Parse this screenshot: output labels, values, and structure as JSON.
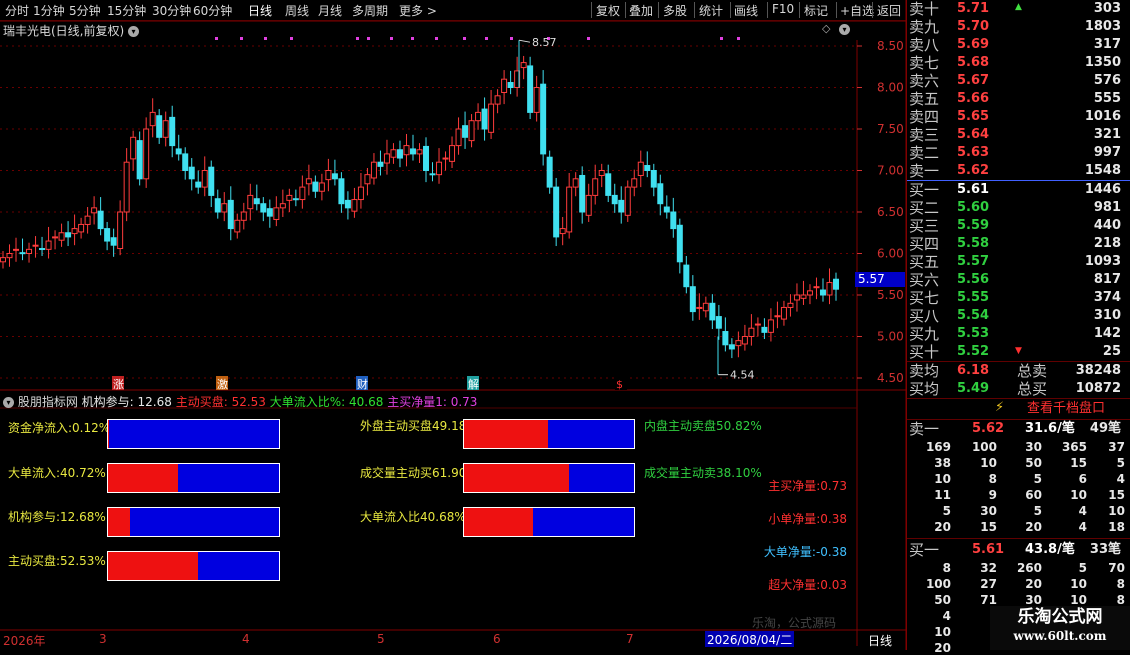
{
  "toolbar": {
    "periods": [
      "分时",
      "1分钟",
      "5分钟",
      "15分钟",
      "30分钟",
      "60分钟",
      "日线",
      "周线",
      "月线",
      "多周期",
      "更多 >"
    ],
    "active_period": "日线",
    "actions": [
      "复权",
      "叠加",
      "多股",
      "统计",
      "画线",
      "F10",
      "标记",
      "+自选",
      "返回"
    ]
  },
  "stock": {
    "title": "瑞丰光电(日线,前复权)"
  },
  "main_chart": {
    "price_ticks": [
      "8.50",
      "8.00",
      "7.50",
      "7.00",
      "6.50",
      "6.00",
      "5.50",
      "5.00",
      "4.50"
    ],
    "current_price_tag": "5.57",
    "high_label": "8.57",
    "low_label": "4.54",
    "event_markers": [
      "涨",
      "激",
      "财",
      "解",
      "$"
    ]
  },
  "indicator": {
    "name": "股朋指标网",
    "header": {
      "jgcy": "机构参与: 12.68",
      "zdmp": "主动买盘: 52.53",
      "ddlrb": "大单流入比%: 40.68",
      "zmjl": "主买净量1: 0.73"
    },
    "bars": [
      {
        "label": "资金净流入:0.12%",
        "fill": 0.0012
      },
      {
        "label": "大单流入:40.72%",
        "fill": 0.4072
      },
      {
        "label": "机构参与:12.68%",
        "fill": 0.1268
      },
      {
        "label": "主动买盘:52.53%",
        "fill": 0.5253
      },
      {
        "label": "外盘主动买盘49.18%",
        "fill": 0.4918
      },
      {
        "label": "成交量主动买61.90%",
        "fill": 0.619
      },
      {
        "label": "大单流入比40.68%",
        "fill": 0.4068
      }
    ],
    "right_labels": [
      "内盘主动卖盘50.82%",
      "成交量主动卖38.10%"
    ],
    "net": [
      {
        "label": "主买净量:0.73",
        "color": "#ff3030"
      },
      {
        "label": "小单净量:0.38",
        "color": "#ff3030"
      },
      {
        "label": "大单净量:-0.38",
        "color": "#40c0ff"
      },
      {
        "label": "超大净量:0.03",
        "color": "#ff3030"
      }
    ],
    "faint_text": "乐淘，公式源码"
  },
  "date_axis": {
    "year": "2026年",
    "months": [
      "3",
      "4",
      "5",
      "6",
      "7"
    ],
    "cursor_date": "2026/08/04/二",
    "period": "日线"
  },
  "orderbook": {
    "asks": [
      {
        "label": "卖十",
        "price": "5.71",
        "vol": "303"
      },
      {
        "label": "卖九",
        "price": "5.70",
        "vol": "1803"
      },
      {
        "label": "卖八",
        "price": "5.69",
        "vol": "317"
      },
      {
        "label": "卖七",
        "price": "5.68",
        "vol": "1350"
      },
      {
        "label": "卖六",
        "price": "5.67",
        "vol": "576"
      },
      {
        "label": "卖五",
        "price": "5.66",
        "vol": "555"
      },
      {
        "label": "卖四",
        "price": "5.65",
        "vol": "1016"
      },
      {
        "label": "卖三",
        "price": "5.64",
        "vol": "321"
      },
      {
        "label": "卖二",
        "price": "5.63",
        "vol": "997"
      },
      {
        "label": "卖一",
        "price": "5.62",
        "vol": "1548"
      }
    ],
    "bids": [
      {
        "label": "买一",
        "price": "5.61",
        "vol": "1446"
      },
      {
        "label": "买二",
        "price": "5.60",
        "vol": "981"
      },
      {
        "label": "买三",
        "price": "5.59",
        "vol": "440"
      },
      {
        "label": "买四",
        "price": "5.58",
        "vol": "218"
      },
      {
        "label": "买五",
        "price": "5.57",
        "vol": "1093"
      },
      {
        "label": "买六",
        "price": "5.56",
        "vol": "817"
      },
      {
        "label": "买七",
        "price": "5.55",
        "vol": "374"
      },
      {
        "label": "买八",
        "price": "5.54",
        "vol": "310"
      },
      {
        "label": "买九",
        "price": "5.53",
        "vol": "142"
      },
      {
        "label": "买十",
        "price": "5.52",
        "vol": "25"
      }
    ],
    "avg_sell": {
      "label": "卖均",
      "price": "6.18",
      "tlabel": "总卖",
      "vol": "38248"
    },
    "avg_buy": {
      "label": "买均",
      "price": "5.49",
      "tlabel": "总买",
      "vol": "10872"
    },
    "view_button": "查看千档盘口",
    "sell1": {
      "label": "卖一",
      "price": "5.62",
      "per": "31.6/笔",
      "count": "49笔"
    },
    "sell1_grid": [
      [
        "169",
        "100",
        "30",
        "365",
        "37"
      ],
      [
        "38",
        "10",
        "50",
        "15",
        "5"
      ],
      [
        "10",
        "8",
        "5",
        "6",
        "4"
      ],
      [
        "11",
        "9",
        "60",
        "10",
        "15"
      ],
      [
        "5",
        "30",
        "5",
        "4",
        "10"
      ],
      [
        "20",
        "15",
        "20",
        "4",
        "18"
      ]
    ],
    "buy1": {
      "label": "买一",
      "price": "5.61",
      "per": "43.8/笔",
      "count": "33笔"
    },
    "buy1_grid": [
      [
        "8",
        "32",
        "260",
        "5",
        "70"
      ],
      [
        "100",
        "27",
        "20",
        "10",
        "8"
      ],
      [
        "50",
        "71",
        "30",
        "10",
        "8"
      ],
      [
        "4",
        "",
        "",
        "",
        ""
      ],
      [
        "10",
        "",
        "",
        "",
        ""
      ],
      [
        "20",
        "",
        "",
        "",
        ""
      ]
    ]
  },
  "watermark": {
    "title": "乐淘公式网",
    "url": "www.60lt.com"
  }
}
